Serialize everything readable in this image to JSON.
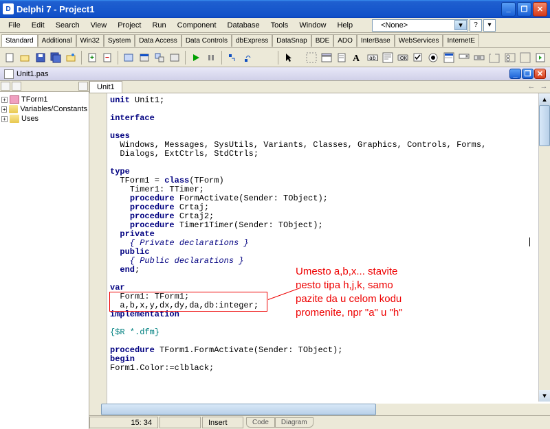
{
  "title": "Delphi 7 - Project1",
  "menu": [
    "File",
    "Edit",
    "Search",
    "View",
    "Project",
    "Run",
    "Component",
    "Database",
    "Tools",
    "Window",
    "Help"
  ],
  "combo_value": "<None>",
  "palette_tabs": [
    "Standard",
    "Additional",
    "Win32",
    "System",
    "Data Access",
    "Data Controls",
    "dbExpress",
    "DataSnap",
    "BDE",
    "ADO",
    "InterBase",
    "WebServices",
    "InternetE"
  ],
  "doc_title": "Unit1.pas",
  "tree": [
    {
      "label": "TForm1"
    },
    {
      "label": "Variables/Constants"
    },
    {
      "label": "Uses"
    }
  ],
  "editor_tab": "Unit1",
  "code": {
    "l1a": "unit",
    "l1b": " Unit1;",
    "l2": "interface",
    "l3": "uses",
    "l4": "  Windows, Messages, SysUtils, Variants, Classes, Graphics, Controls, Forms,",
    "l5": "  Dialogs, ExtCtrls, StdCtrls;",
    "l6": "type",
    "l7a": "  TForm1 = ",
    "l7b": "class",
    "l7c": "(TForm)",
    "l8": "    Timer1: TTimer;",
    "l9a": "    ",
    "l9b": "procedure",
    "l9c": " FormActivate(Sender: TObject);",
    "l10a": "    ",
    "l10b": "procedure",
    "l10c": " Crtaj;",
    "l11a": "    ",
    "l11b": "procedure",
    "l11c": " Crtaj2;",
    "l12a": "    ",
    "l12b": "procedure",
    "l12c": " Timer1Timer(Sender: TObject);",
    "l13": "  private",
    "l14": "    { Private declarations }",
    "l15": "  public",
    "l16": "    { Public declarations }",
    "l17a": "  ",
    "l17b": "end",
    "l17c": ";",
    "l18": "var",
    "l19": "  Form1: TForm1;",
    "l20": "  a,b,x,y,dx,dy,da,db:integer;",
    "l21": "implementation",
    "l22": "{$R *.dfm}",
    "l23a": "procedure",
    "l23b": " TForm1.FormActivate(Sender: TObject);",
    "l24": "begin",
    "l25": "Form1.Color:=clblack;"
  },
  "annotation": "Umesto a,b,x... stavite\nnesto tipa h,j,k, samo\npazite da u celom kodu\npromenite, npr \"a\" u \"h\"",
  "status": {
    "pos": "15: 34",
    "mode": "Insert"
  },
  "bottom_tabs": [
    "Code",
    "Diagram"
  ]
}
